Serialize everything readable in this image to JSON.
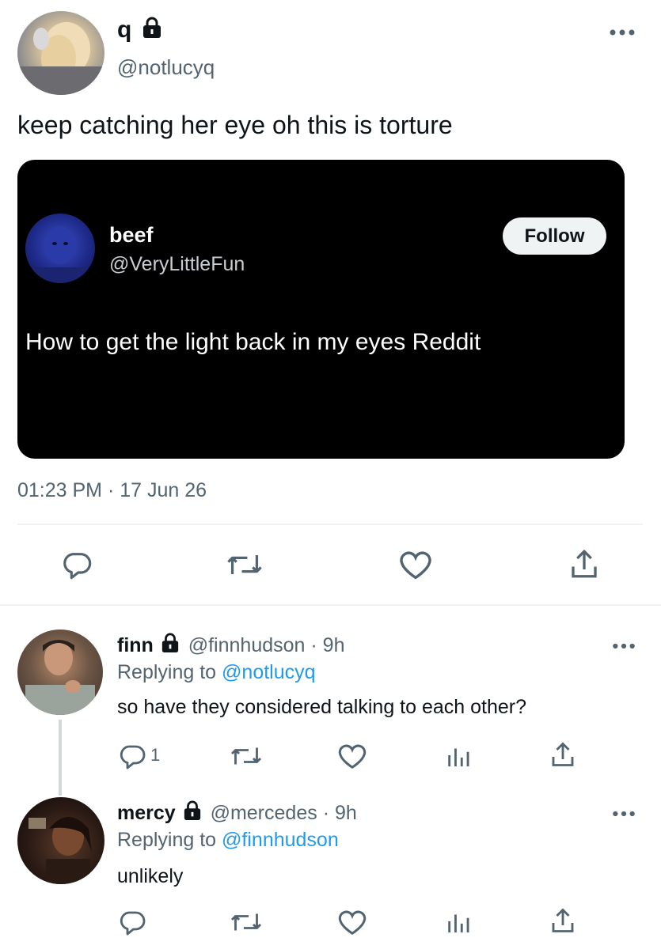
{
  "main_tweet": {
    "display_name": "q",
    "handle": "@notlucyq",
    "text": "keep catching her eye oh this is torture",
    "timestamp": "01:23 PM · 17 Jun 26",
    "embedded": {
      "display_name": "beef",
      "handle": "@VeryLittleFun",
      "follow_label": "Follow",
      "text": "How to get the light back in my eyes Reddit"
    },
    "actions": [
      "reply-icon",
      "retweet-icon",
      "like-icon",
      "share-icon"
    ]
  },
  "replies": [
    {
      "display_name": "finn",
      "handle": "@finnhudson",
      "time": "· 9h",
      "replying_prefix": "Replying to",
      "replying_handle": "@notlucyq",
      "text": "so have they considered talking to each other?",
      "reply_count": "1"
    },
    {
      "display_name": "mercy",
      "handle": "@mercedes",
      "time": "· 9h",
      "replying_prefix": "Replying to",
      "replying_handle": "@finnhudson",
      "text": "unlikely",
      "reply_count": ""
    }
  ],
  "colors": {
    "text": "#0f1419",
    "muted": "#536471",
    "link": "#1d9bf0",
    "divider": "#eff3f4",
    "embed_bg": "#000000"
  }
}
